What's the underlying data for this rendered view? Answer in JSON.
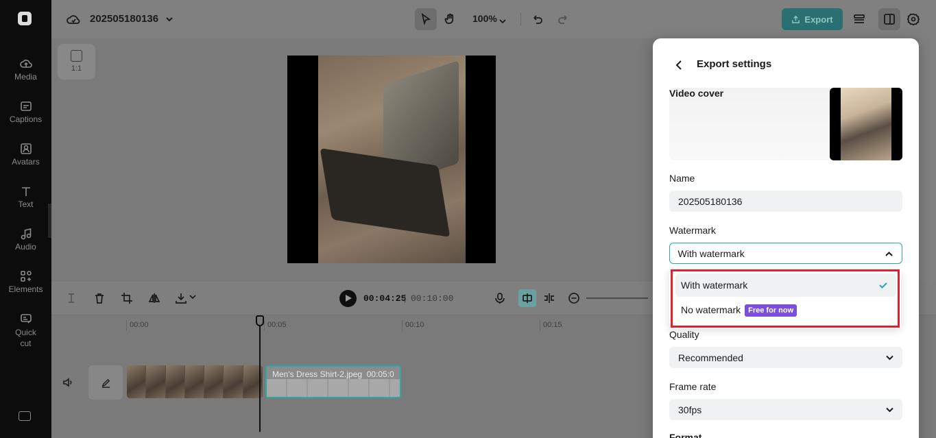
{
  "sidebar": {
    "items": [
      {
        "label": "Media"
      },
      {
        "label": "Captions"
      },
      {
        "label": "Avatars"
      },
      {
        "label": "Text"
      },
      {
        "label": "Audio"
      },
      {
        "label": "Elements"
      },
      {
        "label": "Quick cut"
      }
    ]
  },
  "header": {
    "project_name": "202505180136",
    "zoom": "100%",
    "export_label": "Export"
  },
  "canvas": {
    "ratio_label": "1:1"
  },
  "timeline": {
    "current_time": "00:04:25",
    "separator": "|",
    "total_time": "00:10:00",
    "ticks": [
      "00:00",
      "00:05",
      "00:10",
      "00:15"
    ],
    "clip_label": "Men's Dress Shirt-2.jpeg",
    "clip_duration": "00:05:0"
  },
  "export_panel": {
    "title": "Export settings",
    "video_cover_label": "Video cover",
    "name_label": "Name",
    "name_value": "202505180136",
    "watermark_label": "Watermark",
    "watermark_value": "With watermark",
    "watermark_options": [
      {
        "label": "With watermark",
        "selected": true
      },
      {
        "label": "No watermark",
        "badge": "Free for now"
      }
    ],
    "quality_label": "Quality",
    "quality_value": "Recommended",
    "frame_rate_label": "Frame rate",
    "frame_rate_value": "30fps",
    "format_label": "Format"
  },
  "colors": {
    "accent": "#2ba7a7",
    "export_button": "#2a6f72",
    "badge": "#7b4fd8",
    "highlight": "#e0202e"
  }
}
